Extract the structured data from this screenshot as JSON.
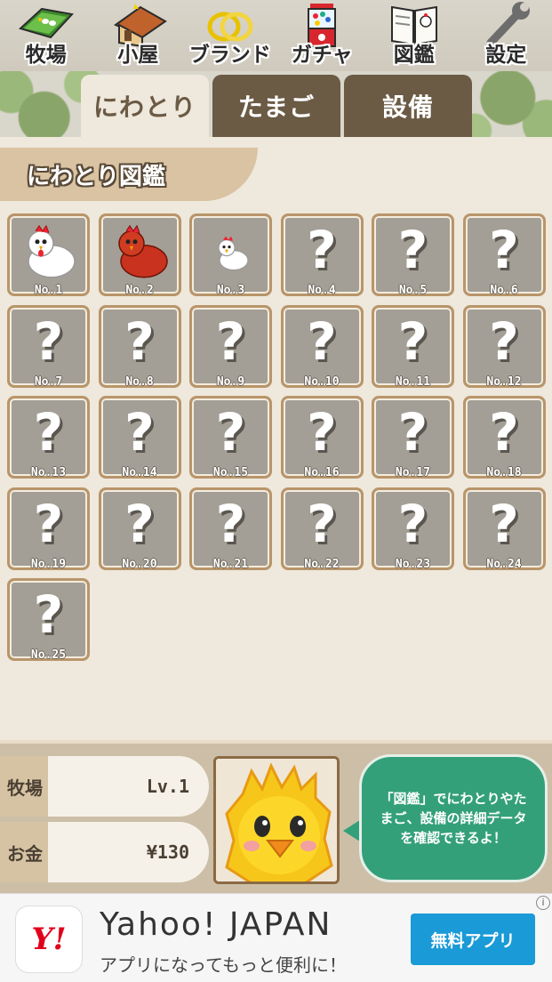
{
  "nav": {
    "items": [
      {
        "label": "牧場",
        "icon": "farm-icon"
      },
      {
        "label": "小屋",
        "icon": "house-icon"
      },
      {
        "label": "ブランド",
        "icon": "rings-icon"
      },
      {
        "label": "ガチャ",
        "icon": "gacha-icon"
      },
      {
        "label": "図鑑",
        "icon": "book-icon"
      },
      {
        "label": "設定",
        "icon": "wrench-icon"
      }
    ]
  },
  "tabs": [
    {
      "label": "にわとり",
      "active": true
    },
    {
      "label": "たまご",
      "active": false
    },
    {
      "label": "設備",
      "active": false
    }
  ],
  "section": {
    "title": "にわとり図鑑"
  },
  "cards": [
    {
      "number": "No.1",
      "state": "white-chicken"
    },
    {
      "number": "No.2",
      "state": "red-chicken"
    },
    {
      "number": "No.3",
      "state": "small-white-chicken"
    },
    {
      "number": "No.4",
      "state": "unknown",
      "mark": "?"
    },
    {
      "number": "No.5",
      "state": "unknown",
      "mark": "?"
    },
    {
      "number": "No.6",
      "state": "unknown",
      "mark": "?"
    },
    {
      "number": "No.7",
      "state": "unknown",
      "mark": "?"
    },
    {
      "number": "No.8",
      "state": "unknown",
      "mark": "?"
    },
    {
      "number": "No.9",
      "state": "unknown",
      "mark": "?"
    },
    {
      "number": "No.10",
      "state": "unknown",
      "mark": "?"
    },
    {
      "number": "No.11",
      "state": "unknown",
      "mark": "?"
    },
    {
      "number": "No.12",
      "state": "unknown",
      "mark": "?"
    },
    {
      "number": "No.13",
      "state": "unknown",
      "mark": "?"
    },
    {
      "number": "No.14",
      "state": "unknown",
      "mark": "?"
    },
    {
      "number": "No.15",
      "state": "unknown",
      "mark": "?"
    },
    {
      "number": "No.16",
      "state": "unknown",
      "mark": "?"
    },
    {
      "number": "No.17",
      "state": "unknown",
      "mark": "?"
    },
    {
      "number": "No.18",
      "state": "unknown",
      "mark": "?"
    },
    {
      "number": "No.19",
      "state": "unknown",
      "mark": "?"
    },
    {
      "number": "No.20",
      "state": "unknown",
      "mark": "?"
    },
    {
      "number": "No.21",
      "state": "unknown",
      "mark": "?"
    },
    {
      "number": "No.22",
      "state": "unknown",
      "mark": "?"
    },
    {
      "number": "No.23",
      "state": "unknown",
      "mark": "?"
    },
    {
      "number": "No.24",
      "state": "unknown",
      "mark": "?"
    },
    {
      "number": "No.25",
      "state": "unknown",
      "mark": "?"
    }
  ],
  "status": {
    "farm_label": "牧場",
    "farm_level": "Lv.1",
    "money_label": "お金",
    "money_value": "¥130",
    "bubble_text": "「図鑑」でにわとりやたまご、設備の詳細データを確認できるよ！"
  },
  "ad": {
    "logo": "Y!",
    "title": "Yahoo! JAPAN",
    "subtitle": "アプリになってもっと便利に！",
    "button": "無料アプリ",
    "info": "i"
  },
  "colors": {
    "tab_dark": "#6b5a44",
    "card_border": "#b8956a",
    "bubble_green": "#33a07a",
    "ad_button": "#1a9ad6",
    "yahoo_red": "#e1001b"
  }
}
